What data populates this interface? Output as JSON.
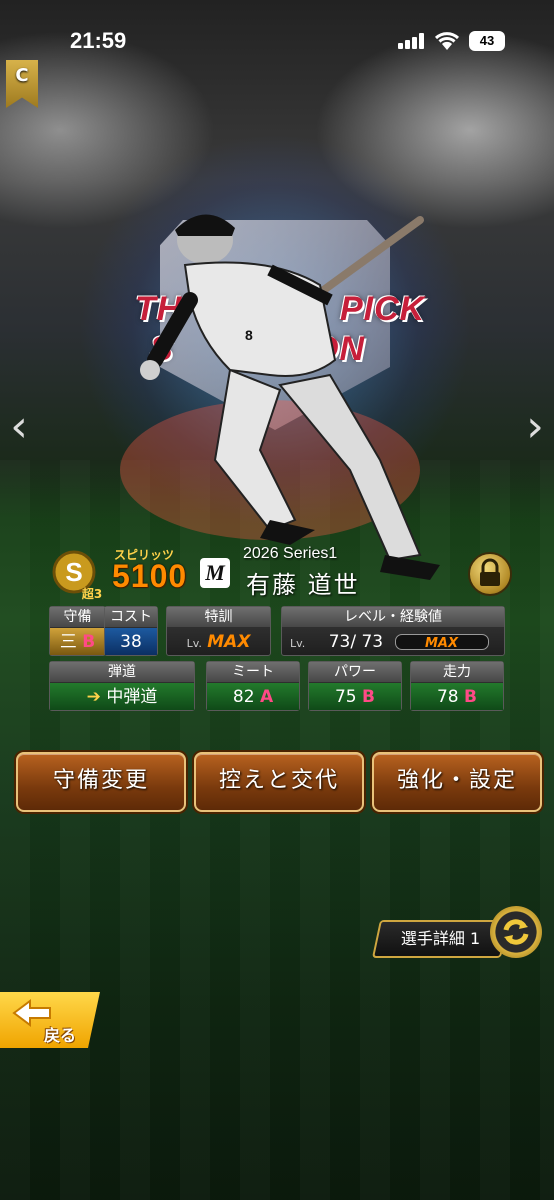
{
  "status_bar": {
    "time": "21:59",
    "battery": "43"
  },
  "rarity": "C",
  "emblem": {
    "line1_left": "TH",
    "line1_right": "PICK",
    "line2_left": "S",
    "line2_right": "ON"
  },
  "player": {
    "spirits_label": "スピリッツ",
    "spirits_value": "5100",
    "rank_label": "超3",
    "team_logo": "M",
    "series": "2026 Series1",
    "name": "有藤 道世"
  },
  "stats": {
    "defense": {
      "header": "守備",
      "position": "三",
      "grade": "B"
    },
    "cost": {
      "header": "コスト",
      "value": "38"
    },
    "training": {
      "header": "特訓",
      "lv": "Lv.",
      "value": "MAX"
    },
    "level": {
      "header": "レベル・経験値",
      "lv": "Lv.",
      "current": "73",
      "max": "73",
      "exp": "MAX"
    },
    "trajectory": {
      "header": "弾道",
      "value": "中弾道"
    },
    "meet": {
      "header": "ミート",
      "value": "82",
      "grade": "A"
    },
    "power": {
      "header": "パワー",
      "value": "75",
      "grade": "B"
    },
    "speed": {
      "header": "走力",
      "value": "78",
      "grade": "B"
    }
  },
  "buttons": {
    "defense_change": "守備変更",
    "bench_swap": "控えと交代",
    "enhance": "強化・設定",
    "player_detail": "選手詳細 1",
    "back": "戻る"
  },
  "colors": {
    "accent": "#ff8a00",
    "grade": "#ff4a86",
    "button": "#7a3a0d"
  }
}
